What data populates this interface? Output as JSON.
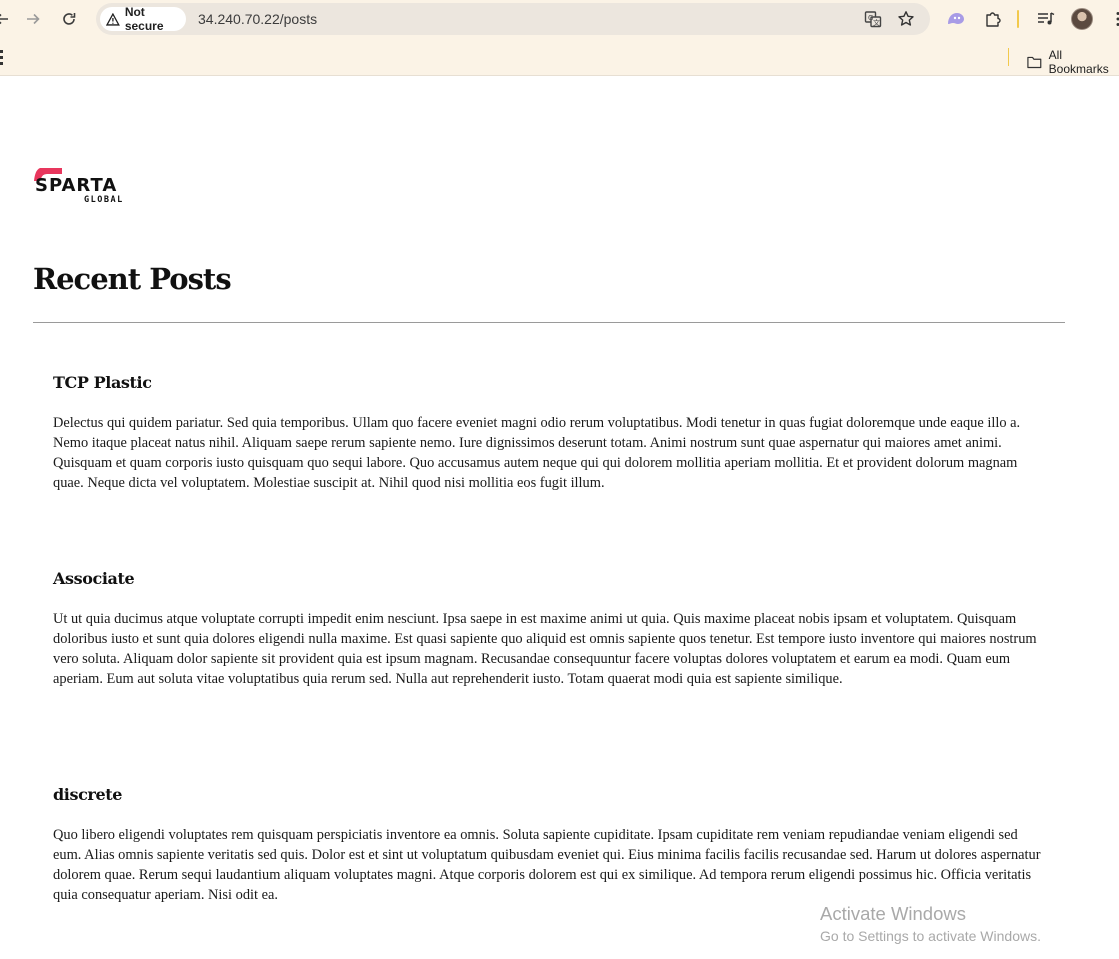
{
  "browser": {
    "security_label": "Not secure",
    "url": "34.240.70.22/posts",
    "bookmarks_label": "All Bookmarks"
  },
  "page": {
    "logo": {
      "word": "SPARTA",
      "sub": "GLOBAL",
      "accent_color": "#e8365d"
    },
    "title": "Recent Posts",
    "posts": [
      {
        "title": "TCP Plastic",
        "body": "Delectus qui quidem pariatur. Sed quia temporibus. Ullam quo facere eveniet magni odio rerum voluptatibus. Modi tenetur in quas fugiat doloremque unde eaque illo a. Nemo itaque placeat natus nihil. Aliquam saepe rerum sapiente nemo. Iure dignissimos deserunt totam. Animi nostrum sunt quae aspernatur qui maiores amet animi. Quisquam et quam corporis iusto quisquam quo sequi labore. Quo accusamus autem neque qui qui dolorem mollitia aperiam mollitia. Et et provident dolorum magnam quae. Neque dicta vel voluptatem. Molestiae suscipit at. Nihil quod nisi mollitia eos fugit illum."
      },
      {
        "title": "Associate",
        "body": "Ut ut quia ducimus atque voluptate corrupti impedit enim nesciunt. Ipsa saepe in est maxime animi ut quia. Quis maxime placeat nobis ipsam et voluptatem. Quisquam doloribus iusto et sunt quia dolores eligendi nulla maxime. Est quasi sapiente quo aliquid est omnis sapiente quos tenetur. Est tempore iusto inventore qui maiores nostrum vero soluta. Aliquam dolor sapiente sit provident quia est ipsum magnam. Recusandae consequuntur facere voluptas dolores voluptatem et earum ea modi. Quam eum aperiam. Eum aut soluta vitae voluptatibus quia rerum sed. Nulla aut reprehenderit iusto. Totam quaerat modi quia est sapiente similique."
      },
      {
        "title": "discrete",
        "body": "Quo libero eligendi voluptates rem quisquam perspiciatis inventore ea omnis. Soluta sapiente cupiditate. Ipsam cupiditate rem veniam repudiandae veniam eligendi sed eum. Alias omnis sapiente veritatis sed quis. Dolor est et sint ut voluptatum quibusdam eveniet qui. Eius minima facilis facilis recusandae sed. Harum ut dolores aspernatur dolorem quae. Rerum sequi laudantium aliquam voluptates magni. Atque corporis dolorem est qui ex similique. Ad tempora rerum eligendi possimus hic. Officia veritatis quia consequatur aperiam. Nisi odit ea."
      }
    ]
  },
  "overlay": {
    "activate_title": "Activate Windows",
    "activate_sub": "Go to Settings to activate Windows."
  },
  "icons": {
    "back": "arrow-left-icon",
    "forward": "arrow-right-icon",
    "reload": "reload-icon",
    "warning": "warning-triangle-icon",
    "translate": "translate-icon",
    "bookmark": "star-icon",
    "extension_blob": "extension-blob-icon",
    "extensions": "puzzle-icon",
    "media": "media-queue-icon",
    "menu": "kebab-menu-icon",
    "folder": "folder-icon"
  }
}
